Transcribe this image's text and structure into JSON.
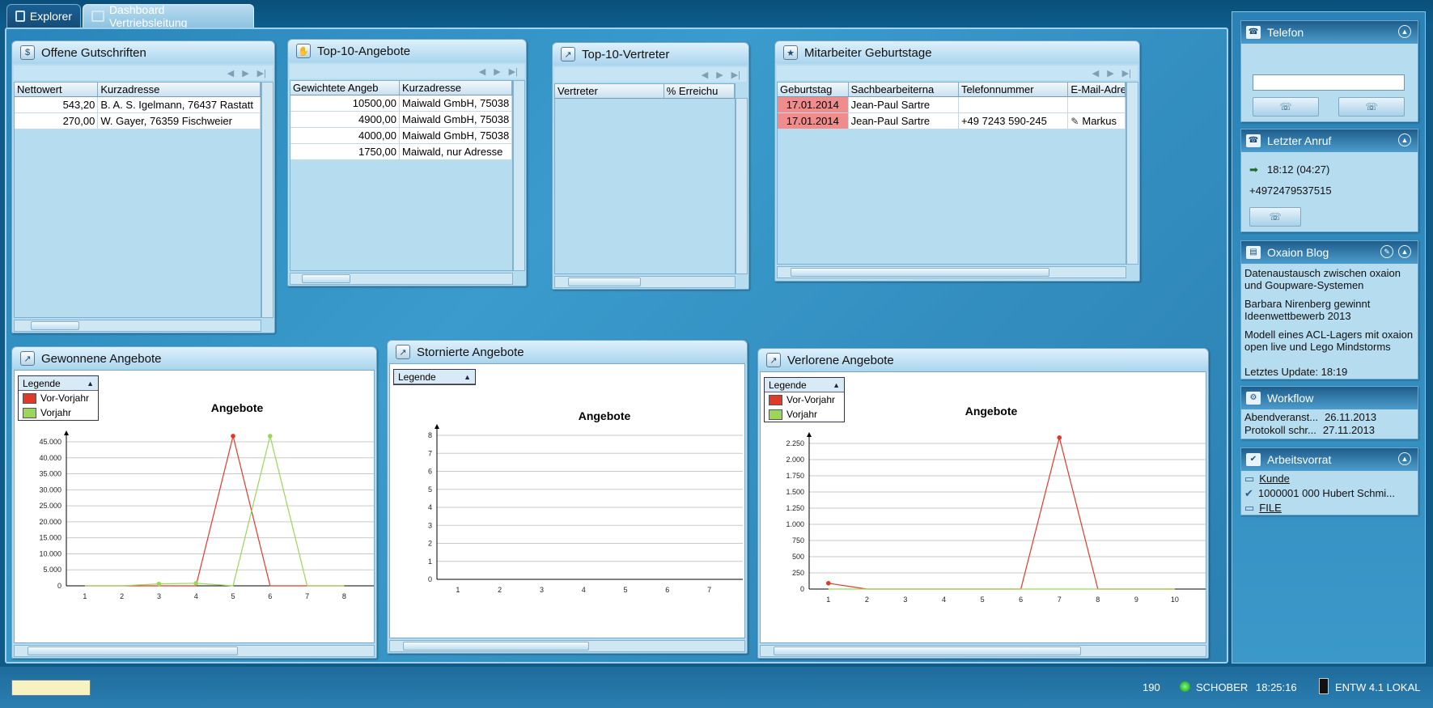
{
  "tabs": [
    {
      "label": "Explorer"
    },
    {
      "label": "Dashboard Vertriebsleitung"
    }
  ],
  "gutschriften": {
    "title": "Offene Gutschriften",
    "columns": [
      "Nettowert",
      "Kurzadresse"
    ],
    "rows": [
      [
        "543,20",
        "B. A. S. Igelmann, 76437 Rastatt"
      ],
      [
        "270,00",
        "W. Gayer, 76359 Fischweier"
      ]
    ]
  },
  "angebote": {
    "title": "Top-10-Angebote",
    "columns": [
      "Gewichtete Angeb",
      "Kurzadresse"
    ],
    "rows": [
      [
        "10500,00",
        "Maiwald GmbH, 75038"
      ],
      [
        "4900,00",
        "Maiwald GmbH, 75038"
      ],
      [
        "4000,00",
        "Maiwald GmbH, 75038"
      ],
      [
        "1750,00",
        "Maiwald, nur Adresse"
      ]
    ]
  },
  "vertreter": {
    "title": "Top-10-Vertreter",
    "columns": [
      "Vertreter",
      "% Erreichu"
    ]
  },
  "geburtstage": {
    "title": "Mitarbeiter Geburtstage",
    "columns": [
      "Geburtstag",
      "Sachbearbeiterna",
      "Telefonnummer",
      "E-Mail-Adre"
    ],
    "rows": [
      [
        "17.01.2014",
        "Jean-Paul Sartre",
        "",
        ""
      ],
      [
        "17.01.2014",
        "Jean-Paul Sartre",
        "+49 7243 590-245",
        "Markus"
      ]
    ],
    "highlight_color": "#f08c8c"
  },
  "charts": {
    "gewonnen": {
      "title": "Gewonnene Angebote"
    },
    "storniert": {
      "title": "Stornierte Angebote"
    },
    "verloren": {
      "title": "Verlorene Angebote"
    },
    "legend_label": "Legende",
    "chart_title": "Angebote"
  },
  "chart_data": [
    {
      "type": "line",
      "title": "Angebote",
      "x": [
        1,
        2,
        3,
        4,
        5,
        6,
        7,
        8
      ],
      "ylim": [
        0,
        45000
      ],
      "yticks": [
        "0",
        "5.000",
        "10.000",
        "15.000",
        "20.000",
        "25.000",
        "30.000",
        "35.000",
        "40.000",
        "45.000"
      ],
      "series": [
        {
          "name": "Vor-Vorjahr",
          "color": "#e0392a",
          "values": [
            0,
            0,
            0,
            0,
            49000,
            0,
            0,
            0
          ]
        },
        {
          "name": "Vorjahr",
          "color": "#9bd65a",
          "values": [
            0,
            0,
            600,
            800,
            0,
            49000,
            0,
            0
          ]
        }
      ]
    },
    {
      "type": "line",
      "title": "Angebote",
      "x": [
        1,
        2,
        3,
        4,
        5,
        6,
        7
      ],
      "ylim": [
        0,
        8
      ],
      "yticks": [
        "0",
        "1",
        "2",
        "3",
        "4",
        "5",
        "6",
        "7",
        "8"
      ],
      "series": []
    },
    {
      "type": "line",
      "title": "Angebote",
      "x": [
        1,
        2,
        3,
        4,
        5,
        6,
        7,
        8,
        9,
        10
      ],
      "ylim": [
        0,
        2250
      ],
      "yticks": [
        "0",
        "250",
        "500",
        "750",
        "1.000",
        "1.250",
        "1.500",
        "1.750",
        "2.000",
        "2.250"
      ],
      "series": [
        {
          "name": "Vor-Vorjahr",
          "color": "#e0392a",
          "values": [
            90,
            0,
            0,
            0,
            0,
            0,
            2400,
            0,
            0,
            0
          ]
        },
        {
          "name": "Vorjahr",
          "color": "#9bd65a",
          "values": [
            0,
            0,
            0,
            0,
            0,
            0,
            0,
            0,
            0,
            0
          ]
        }
      ]
    }
  ],
  "sidebar": {
    "telefon": {
      "title": "Telefon",
      "input_value": ""
    },
    "letzter_anruf": {
      "title": "Letzter Anruf",
      "time": "18:12 (04:27)",
      "number": "+4972479537515"
    },
    "blog": {
      "title": "Oxaion Blog",
      "entries": [
        "Datenaustausch zwischen oxaion und Goupware-Systemen",
        "Barbara Nirenberg gewinnt Ideenwettbewerb 2013",
        "Modell eines ACL-Lagers mit oxaion open live und Lego Mindstorms"
      ],
      "update": "Letztes Update: 18:19"
    },
    "workflow": {
      "title": "Workflow",
      "items": [
        {
          "label": "Abendveranst...",
          "date": "26.11.2013"
        },
        {
          "label": "Protokoll schr...",
          "date": "27.11.2013"
        }
      ]
    },
    "arbeitsvorrat": {
      "title": "Arbeitsvorrat",
      "items": [
        "Kunde",
        "1000001 000 Hubert Schmi...",
        "FILE"
      ]
    }
  },
  "statusbar": {
    "input_value": "",
    "count": "190",
    "user": "SCHOBER",
    "time": "18:25:16",
    "env": "ENTW 4.1 LOKAL"
  }
}
